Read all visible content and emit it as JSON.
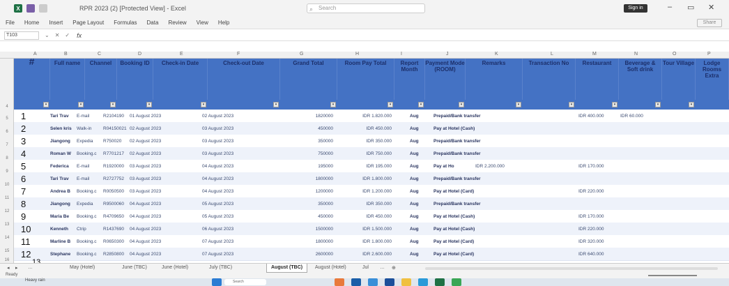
{
  "window": {
    "title": "RPR 2023 (2) [Protected View] - Excel",
    "search_placeholder": "Search",
    "signin_label": "Sign in"
  },
  "ribbon": {
    "tabs": [
      "File",
      "Home",
      "Insert",
      "Page Layout",
      "Formulas",
      "Data",
      "Review",
      "View",
      "Help"
    ],
    "share_label": "Share"
  },
  "formula_bar": {
    "name_box": "T103",
    "fx_label": "fx"
  },
  "column_letters": [
    "A",
    "B",
    "C",
    "D",
    "E",
    "F",
    "G",
    "H",
    "I",
    "J",
    "K",
    "L",
    "M",
    "N",
    "O",
    "P"
  ],
  "headers": {
    "no": "#",
    "guest": "Full name",
    "channel": "Channel",
    "booking": "Booking ID",
    "checkin": "Check-in Date",
    "checkout": "Check-out Date",
    "grand": "Grand Total",
    "room_pay": "Room Pay Total",
    "month": "Report Month",
    "payment": "Payment Mode (ROOM)",
    "notes1": "Remarks",
    "notes2": "Transaction No",
    "resto": "Restaurant",
    "beverage": "Beverage & Soft drink",
    "village": "Tour Village",
    "extra": "Lodge Rooms Extra"
  },
  "rows": [
    {
      "n": "1",
      "guest": "Tari Trav",
      "channel": "E-mail",
      "booking": "R2104190",
      "checkin": "01 August 2023",
      "checkout": "02 August 2023",
      "grand": "1820000",
      "room": "IDR 1.820.000",
      "month": "Aug",
      "pay": "Prepaid/Bank transfer",
      "resto": "IDR 400.000",
      "bev": "IDR 60.000"
    },
    {
      "n": "2",
      "guest": "Selen kris",
      "channel": "Walk-in",
      "booking": "R04150021",
      "checkin": "02 August 2023",
      "checkout": "03 August 2023",
      "grand": "450000",
      "room": "IDR 450.000",
      "month": "Aug",
      "pay": "Pay at Hotel (Cash)",
      "resto": "",
      "bev": ""
    },
    {
      "n": "3",
      "guest": "Jiangong",
      "channel": "Expedia",
      "booking": "R750020",
      "checkin": "02 August 2023",
      "checkout": "03 August 2023",
      "grand": "350000",
      "room": "IDR 350.000",
      "month": "Aug",
      "pay": "Prepaid/Bank transfer",
      "resto": "",
      "bev": ""
    },
    {
      "n": "4",
      "guest": "Roman W",
      "channel": "Booking.c",
      "booking": "R7701217",
      "checkin": "02 August 2023",
      "checkout": "03 August 2023",
      "grand": "750000",
      "room": "IDR 750.000",
      "month": "Aug",
      "pay": "Prepaid/Bank transfer",
      "resto": "",
      "bev": ""
    },
    {
      "n": "5",
      "guest": "Federica",
      "channel": "E-mail",
      "booking": "R1920000",
      "checkin": "03 August 2023",
      "checkout": "04 August 2023",
      "grand": "195000",
      "room": "IDR 195.000",
      "month": "Aug",
      "pay": "Pay at Ho",
      "resto": "IDR 170.000",
      "bev": "",
      "extra_pay": "IDR 2.200.000"
    },
    {
      "n": "6",
      "guest": "Tari Trav",
      "channel": "E-mail",
      "booking": "R2727752",
      "checkin": "03 August 2023",
      "checkout": "04 August 2023",
      "grand": "1800000",
      "room": "IDR 1.800.000",
      "month": "Aug",
      "pay": "Prepaid/Bank transfer",
      "resto": "",
      "bev": ""
    },
    {
      "n": "7",
      "guest": "Andrea B",
      "channel": "Booking.c",
      "booking": "R0050500",
      "checkin": "03 August 2023",
      "checkout": "04 August 2023",
      "grand": "1200000",
      "room": "IDR 1.200.000",
      "month": "Aug",
      "pay": "Pay at Hotel (Card)",
      "resto": "IDR 220.000",
      "bev": ""
    },
    {
      "n": "8",
      "guest": "Jiangong",
      "channel": "Expedia",
      "booking": "R9500060",
      "checkin": "04 August 2023",
      "checkout": "05 August 2023",
      "grand": "350000",
      "room": "IDR 350.000",
      "month": "Aug",
      "pay": "Prepaid/Bank transfer",
      "resto": "",
      "bev": ""
    },
    {
      "n": "9",
      "guest": "Maria Be",
      "channel": "Booking.c",
      "booking": "R4709650",
      "checkin": "04 August 2023",
      "checkout": "05 August 2023",
      "grand": "450000",
      "room": "IDR 450.000",
      "month": "Aug",
      "pay": "Pay at Hotel (Cash)",
      "resto": "IDR 170.000",
      "bev": ""
    },
    {
      "n": "10",
      "guest": "Kenneth",
      "channel": "Ctrip",
      "booking": "R1437690",
      "checkin": "04 August 2023",
      "checkout": "06 August 2023",
      "grand": "1500000",
      "room": "IDR 1.500.000",
      "month": "Aug",
      "pay": "Pay at Hotel (Cash)",
      "resto": "IDR 220.000",
      "bev": ""
    },
    {
      "n": "11",
      "guest": "Marline B",
      "channel": "Booking.c",
      "booking": "R0650300",
      "checkin": "04 August 2023",
      "checkout": "07 August 2023",
      "grand": "1800000",
      "room": "IDR 1.800.000",
      "month": "Aug",
      "pay": "Pay at Hotel (Card)",
      "resto": "IDR 320.000",
      "bev": ""
    },
    {
      "n": "12",
      "guest": "Stephane",
      "channel": "Booking.c",
      "booking": "R2850800",
      "checkin": "04 August 2023",
      "checkout": "07 August 2023",
      "grand": "2600000",
      "room": "IDR 2.600.000",
      "month": "Aug",
      "pay": "Pay at Hotel (Card)",
      "resto": "IDR 640.000",
      "bev": ""
    }
  ],
  "row_numbers": [
    "4",
    "5",
    "6",
    "7",
    "8",
    "9",
    "10",
    "11",
    "12",
    "13",
    "14",
    "15",
    "16"
  ],
  "last_partial_no": "13",
  "sheet_tabs": [
    "May (Hotel)",
    "June (TBC)",
    "June (Hotel)",
    "July (TBC)",
    "August (TBC)",
    "August (Hotel)",
    "Jul"
  ],
  "active_sheet": "August (TBC)",
  "status": {
    "ready": "Ready"
  },
  "taskbar": {
    "weather": "Heavy rain",
    "search": "Search"
  },
  "colors": {
    "header_blue": "#4472c4",
    "highlight": "#ffc000"
  }
}
